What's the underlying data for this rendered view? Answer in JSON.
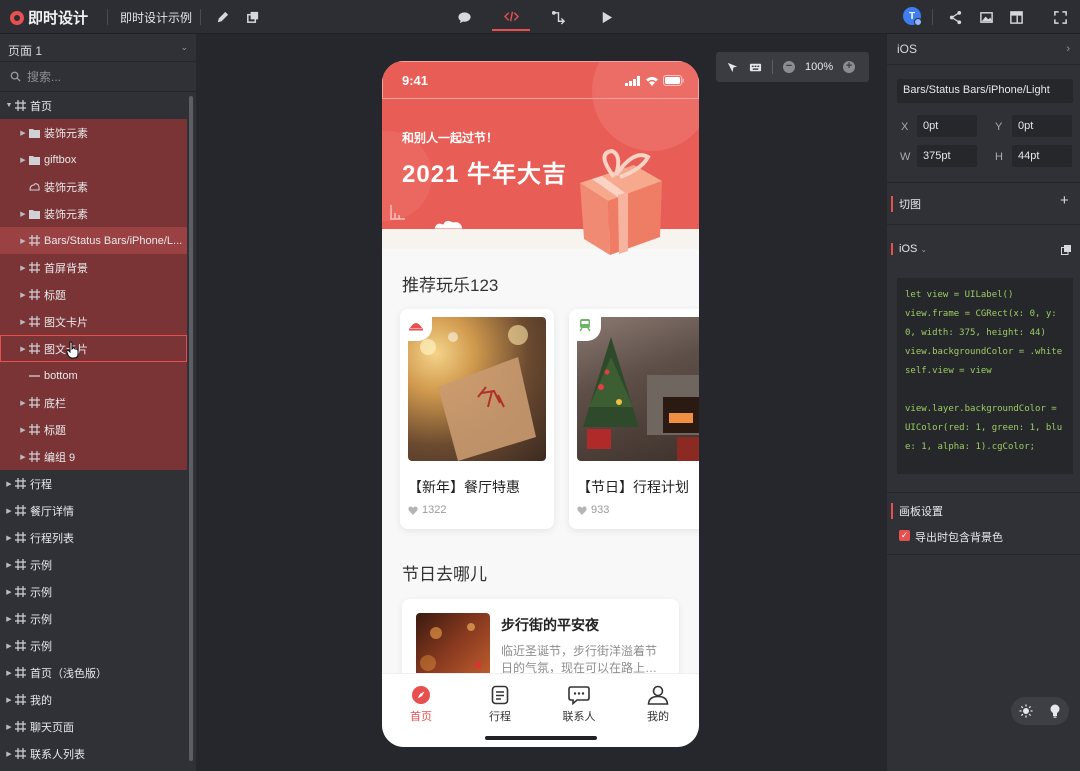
{
  "topbar": {
    "logo_text": "即时设计",
    "project_name": "即时设计示例",
    "avatar_letter": "T"
  },
  "left_panel": {
    "page_name": "页面 1",
    "search_placeholder": "搜索...",
    "layers": [
      {
        "label": "首页",
        "level": 0,
        "icon": "frame-icon",
        "expanded": true
      },
      {
        "label": "装饰元素",
        "level": 1,
        "icon": "folder-icon"
      },
      {
        "label": "giftbox",
        "level": 1,
        "icon": "folder-icon"
      },
      {
        "label": "装饰元素",
        "level": 1,
        "icon": "vector-icon"
      },
      {
        "label": "装饰元素",
        "level": 1,
        "icon": "folder-icon"
      },
      {
        "label": "Bars/Status Bars/iPhone/L...",
        "level": 1,
        "icon": "frame-icon",
        "selected": true
      },
      {
        "label": "首屏背景",
        "level": 1,
        "icon": "frame-icon"
      },
      {
        "label": "标题",
        "level": 1,
        "icon": "frame-icon"
      },
      {
        "label": "图文卡片",
        "level": 1,
        "icon": "frame-icon"
      },
      {
        "label": "图文卡片",
        "level": 1,
        "icon": "frame-icon",
        "hovered": true
      },
      {
        "label": "bottom",
        "level": 1,
        "icon": "line-icon"
      },
      {
        "label": "底栏",
        "level": 1,
        "icon": "frame-icon"
      },
      {
        "label": "标题",
        "level": 1,
        "icon": "frame-icon"
      },
      {
        "label": "编组 9",
        "level": 1,
        "icon": "frame-icon"
      },
      {
        "label": "行程",
        "level": 0,
        "icon": "frame-icon"
      },
      {
        "label": "餐厅详情",
        "level": 0,
        "icon": "frame-icon"
      },
      {
        "label": "行程列表",
        "level": 0,
        "icon": "frame-icon"
      },
      {
        "label": "示例",
        "level": 0,
        "icon": "frame-icon"
      },
      {
        "label": "示例",
        "level": 0,
        "icon": "frame-icon"
      },
      {
        "label": "示例",
        "level": 0,
        "icon": "frame-icon"
      },
      {
        "label": "示例",
        "level": 0,
        "icon": "frame-icon"
      },
      {
        "label": "首页（浅色版）",
        "level": 0,
        "icon": "frame-icon"
      },
      {
        "label": "我的",
        "level": 0,
        "icon": "frame-icon"
      },
      {
        "label": "聊天页面",
        "level": 0,
        "icon": "frame-icon"
      },
      {
        "label": "联系人列表",
        "level": 0,
        "icon": "frame-icon"
      }
    ]
  },
  "zoom": {
    "level": "100%"
  },
  "phone": {
    "status_time": "9:41",
    "hero_subtitle": "和别人一起过节！",
    "hero_title": "2021 牛年大吉",
    "section1_title": "推荐玩乐123",
    "cards": [
      {
        "title": "【新年】餐厅特惠",
        "likes": "1322",
        "badge_icon": "dining-icon"
      },
      {
        "title": "【节日】行程计划",
        "likes": "933",
        "badge_icon": "train-icon"
      }
    ],
    "section2_title": "节日去哪儿",
    "feature": {
      "title": "步行街的平安夜",
      "desc": "临近圣诞节，步行街洋溢着节日的气氛，现在可以在路上…"
    },
    "tabs": [
      {
        "label": "首页",
        "icon": "compass-icon",
        "active": true
      },
      {
        "label": "行程",
        "icon": "document-icon"
      },
      {
        "label": "联系人",
        "icon": "chat-icon"
      },
      {
        "label": "我的",
        "icon": "person-icon"
      }
    ]
  },
  "right_panel": {
    "platform": "iOS",
    "layer_name": "Bars/Status Bars/iPhone/Light",
    "x_label": "X",
    "x": "0pt",
    "y_label": "Y",
    "y": "0pt",
    "w_label": "W",
    "w": "375pt",
    "h_label": "H",
    "h": "44pt",
    "slice_title": "切图",
    "code_platform": "iOS",
    "code": "let view = UILabel()\nview.frame = CGRect(x: 0, y: 0, width: 375, height: 44)\nview.backgroundColor = .white\nself.view = view\n\nview.layer.backgroundColor = UIColor(red: 1, green: 1, blue: 1, alpha: 1).cgColor;",
    "board_settings_title": "画板设置",
    "export_bg_label": "导出时包含背景色"
  },
  "colors": {
    "accent": "#e8504f",
    "hero": "#e85d55",
    "selection": "#7a3436"
  }
}
